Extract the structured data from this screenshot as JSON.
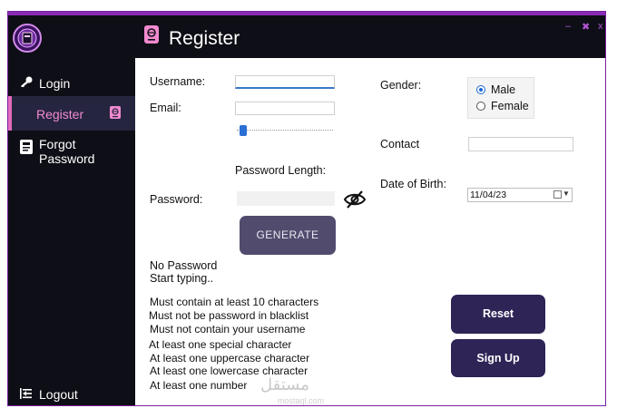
{
  "window": {
    "title": "Register",
    "controls": {
      "minimize": "–",
      "restore": "✖",
      "close": "x"
    }
  },
  "sidebar": {
    "items": [
      {
        "label": "Login",
        "icon": "key-icon"
      },
      {
        "label": "Register",
        "icon": "passport-icon",
        "active": true
      },
      {
        "label": "Forgot Password",
        "icon": "id-card-icon"
      }
    ],
    "logout": {
      "label": "Logout",
      "icon": "logout-icon"
    }
  },
  "form": {
    "username_label": "Username:",
    "username_value": "",
    "email_label": "Email:",
    "email_value": "",
    "password_length_label": "Password Length:",
    "password_length_fraction": 0.05,
    "password_label": "Password:",
    "password_value": "",
    "generate_label": "GENERATE",
    "gender_label": "Gender:",
    "gender_options": [
      "Male",
      "Female"
    ],
    "gender_selected": "Male",
    "contact_label": "Contact",
    "contact_value": "",
    "dob_label": "Date of Birth:",
    "dob_value": "11/04/23"
  },
  "status": {
    "strength": "No Password",
    "hint": "Start typing.."
  },
  "rules": [
    "Must contain at least 10 characters",
    "Must not be password in blacklist",
    "Must not contain your username",
    "At least one special character",
    "At least one uppercase character",
    "At least one lowercase character",
    "At least one number"
  ],
  "actions": {
    "reset_label": "Reset",
    "signup_label": "Sign Up"
  },
  "watermark": {
    "text": "مستقل",
    "sub": "mostaql.com"
  },
  "colors": {
    "sidebar_bg": "#0e0e16",
    "accent_pink": "#e26bbd",
    "button_dark": "#2e2456",
    "generate": "#514c6e",
    "border": "#7a1fa0"
  }
}
